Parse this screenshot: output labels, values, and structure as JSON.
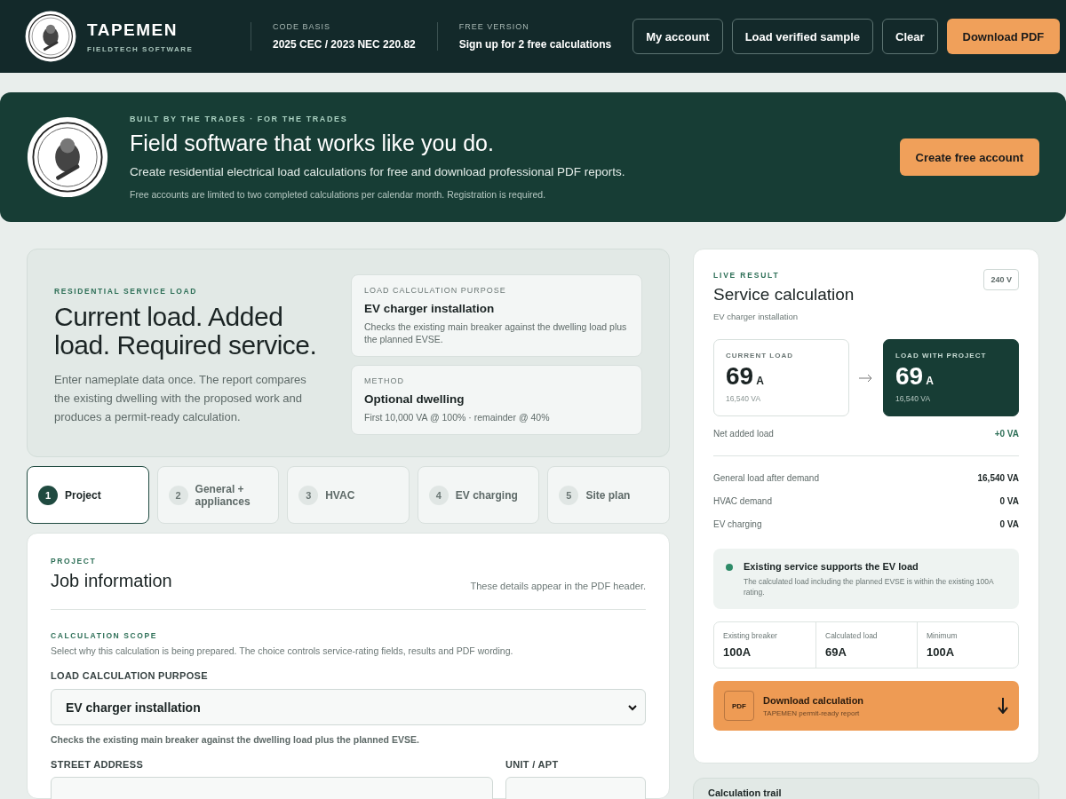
{
  "header": {
    "brand": {
      "name": "TAPEMEN",
      "tagline": "FIELDTECH SOFTWARE"
    },
    "info": [
      {
        "label": "CODE BASIS",
        "value": "2025 CEC / 2023 NEC 220.82"
      },
      {
        "label": "FREE VERSION",
        "value": "Sign up for 2 free calculations"
      }
    ],
    "buttons": [
      {
        "label": "My account",
        "kind": "outline"
      },
      {
        "label": "Load verified sample",
        "kind": "outline"
      },
      {
        "label": "Clear",
        "kind": "outline"
      },
      {
        "label": "Download PDF",
        "kind": "primary"
      }
    ]
  },
  "hero": {
    "eyebrow": "BUILT BY THE TRADES · FOR THE TRADES",
    "title": "Field software that works like you do.",
    "subtitle": "Create residential electrical load calculations for free and download professional PDF reports.",
    "note": "Free accounts are limited to two completed calculations per calendar month. Registration is required.",
    "button": "Create free account"
  },
  "intro": {
    "eyebrow": "RESIDENTIAL SERVICE LOAD",
    "title": "Current load. Added load. Required service.",
    "body": "Enter nameplate data once. The report compares the existing dwelling with the proposed work and produces a permit-ready calculation.",
    "cards": [
      {
        "label": "LOAD CALCULATION PURPOSE",
        "title": "EV charger installation",
        "body": "Checks the existing main breaker against the dwelling load plus the planned EVSE."
      },
      {
        "label": "METHOD",
        "title": "Optional dwelling",
        "body": "First 10,000 VA @ 100% · remainder @ 40%"
      }
    ]
  },
  "steps": [
    {
      "number": "1",
      "label": "Project",
      "selected": true
    },
    {
      "number": "2",
      "label": "General + appliances",
      "selected": false
    },
    {
      "number": "3",
      "label": "HVAC",
      "selected": false
    },
    {
      "number": "4",
      "label": "EV charging",
      "selected": false
    },
    {
      "number": "5",
      "label": "Site plan",
      "selected": false
    }
  ],
  "project": {
    "eyebrow": "PROJECT",
    "title": "Job information",
    "note": "These details appear in the PDF header.",
    "scope": {
      "eyebrow": "CALCULATION SCOPE",
      "body": "Select why this calculation is being prepared. The choice controls service-rating fields, results and PDF wording."
    },
    "purpose": {
      "label": "LOAD CALCULATION PURPOSE",
      "value": "EV charger installation",
      "help": "Checks the existing main breaker against the dwelling load plus the planned EVSE."
    },
    "fields": [
      {
        "label": "STREET ADDRESS"
      },
      {
        "label": "UNIT / APT"
      }
    ]
  },
  "result": {
    "eyebrow": "LIVE RESULT",
    "title": "Service calculation",
    "subtitle": "EV charger installation",
    "voltage": "240 V",
    "loads": [
      {
        "label": "CURRENT LOAD",
        "amps": "69",
        "unit": "A",
        "va": "16,540 VA",
        "kind": "current"
      },
      {
        "label": "LOAD WITH PROJECT",
        "amps": "69",
        "unit": "A",
        "va": "16,540 VA",
        "kind": "project"
      }
    ],
    "net": {
      "label": "Net added load",
      "value": "+0 VA"
    },
    "rows": [
      {
        "label": "General load after demand",
        "value": "16,540 VA"
      },
      {
        "label": "HVAC demand",
        "value": "0 VA"
      },
      {
        "label": "EV charging",
        "value": "0 VA"
      }
    ],
    "status": {
      "color": "#2e8b68",
      "title": "Existing service supports the EV load",
      "body": "The calculated load including the planned EVSE is within the existing 100A rating."
    },
    "stats": [
      {
        "label": "Existing breaker",
        "value": "100A"
      },
      {
        "label": "Calculated load",
        "value": "69A"
      },
      {
        "label": "Minimum",
        "value": "100A"
      }
    ],
    "download": {
      "badge": "PDF",
      "title": "Download calculation",
      "subtitle": "TAPEMEN permit-ready report"
    }
  },
  "trail": {
    "title": "Calculation trail"
  }
}
